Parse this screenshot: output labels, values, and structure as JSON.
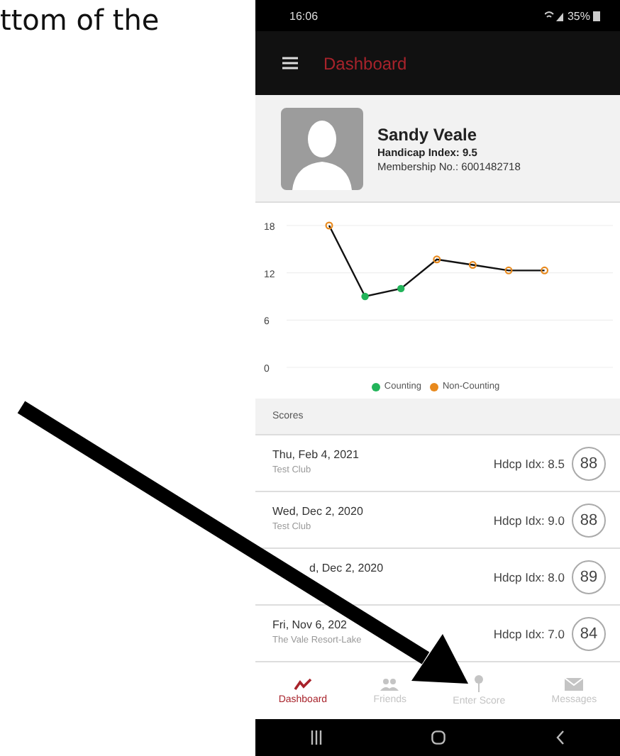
{
  "document_text": "ttom of the",
  "phone": {
    "status_bar": {
      "time": "16:06",
      "battery": "35%"
    },
    "app_bar": {
      "title": "Dashboard"
    },
    "profile": {
      "name": "Sandy Veale",
      "handicap": "Handicap Index: 9.5",
      "membership": "Membership No.: 6001482718"
    },
    "chart": {
      "chart_data": {
        "type": "line",
        "yticks": [
          0,
          6,
          12,
          18
        ],
        "ylim": [
          0,
          18
        ],
        "legend": "bottom",
        "series": [
          {
            "color": "#111111",
            "values": [
              18,
              9,
              10,
              13.7,
              13,
              12.3,
              12.3
            ]
          },
          {
            "name": "Counting",
            "type": "scatter",
            "marker": "circle",
            "color": "#22b45a",
            "values": [
              null,
              9,
              10,
              null,
              null,
              null,
              null
            ]
          },
          {
            "name": "Non-Counting",
            "type": "scatter",
            "marker": "circle",
            "color": "#e8891c",
            "values": [
              18,
              null,
              null,
              13.7,
              13,
              12.3,
              12.3
            ]
          }
        ]
      }
    },
    "scores_header": "Scores",
    "scores": [
      {
        "date": "Thu, Feb 4, 2021",
        "club": "Test Club",
        "hdcp": "Hdcp Idx: 8.5",
        "score": "88"
      },
      {
        "date": "Wed, Dec 2, 2020",
        "club": "Test Club",
        "hdcp": "Hdcp Idx: 9.0",
        "score": "88"
      },
      {
        "date": "d, Dec 2, 2020",
        "hdcp": "Hdcp Idx: 8.0",
        "score": "89"
      },
      {
        "date": "Fri, Nov 6, 202",
        "club": "The Vale Resort-Lake",
        "hdcp": "Hdcp Idx: 7.0",
        "score": "84"
      }
    ],
    "bottom_nav": [
      {
        "kind": "chart",
        "label": "Dashboard",
        "selected": true
      },
      {
        "kind": "people",
        "label": "Friends",
        "selected": false
      },
      {
        "kind": "pin",
        "label": "Enter Score",
        "selected": false
      },
      {
        "kind": "mail",
        "label": "Messages",
        "selected": false
      }
    ]
  }
}
